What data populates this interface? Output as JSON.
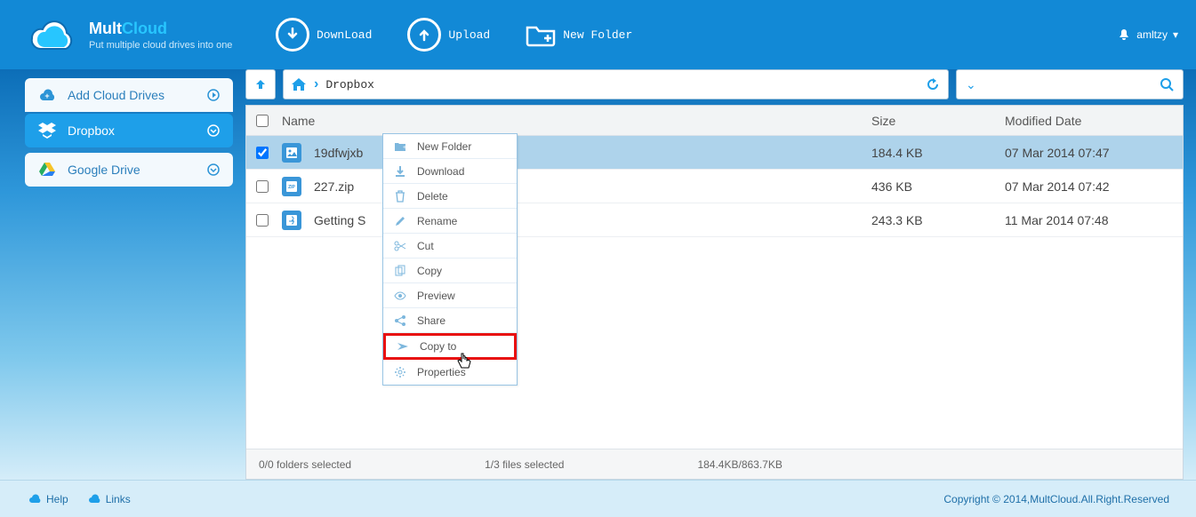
{
  "brand": {
    "name1": "Mult",
    "name2": "Cloud",
    "tagline": "Put multiple cloud drives into one"
  },
  "header": {
    "download": "DownLoad",
    "upload": "Upload",
    "new_folder": "New Folder",
    "username": "amltzy"
  },
  "sidebar": {
    "add_label": "Add Cloud Drives",
    "items": [
      {
        "label": "Dropbox",
        "active": true
      },
      {
        "label": "Google Drive",
        "active": false
      }
    ]
  },
  "breadcrumb": {
    "path": "Dropbox"
  },
  "table": {
    "headers": {
      "name": "Name",
      "size": "Size",
      "date": "Modified Date"
    },
    "rows": [
      {
        "name": "19dfwjxb",
        "size": "184.4 KB",
        "date": "07 Mar 2014 07:47",
        "selected": true,
        "icon": "img"
      },
      {
        "name": "227.zip",
        "size": "436 KB",
        "date": "07 Mar 2014 07:42",
        "selected": false,
        "icon": "zip"
      },
      {
        "name": "Getting S",
        "size": "243.3 KB",
        "date": "11 Mar 2014 07:48",
        "selected": false,
        "icon": "pdf"
      }
    ]
  },
  "context_menu": {
    "items": [
      {
        "label": "New Folder",
        "icon": "folder-plus"
      },
      {
        "label": "Download",
        "icon": "download"
      },
      {
        "label": "Delete",
        "icon": "trash"
      },
      {
        "label": "Rename",
        "icon": "pencil"
      },
      {
        "label": "Cut",
        "icon": "scissors"
      },
      {
        "label": "Copy",
        "icon": "copy"
      },
      {
        "label": "Preview",
        "icon": "eye"
      },
      {
        "label": "Share",
        "icon": "share"
      },
      {
        "label": "Copy to",
        "icon": "send",
        "highlight": true
      },
      {
        "label": "Properties",
        "icon": "gear"
      }
    ]
  },
  "status": {
    "folders": "0/0 folders selected",
    "files": "1/3 files selected",
    "size": "184.4KB/863.7KB"
  },
  "footer": {
    "help": "Help",
    "links": "Links",
    "copyright": "Copyright © 2014,MultCloud.All.Right.Reserved"
  }
}
